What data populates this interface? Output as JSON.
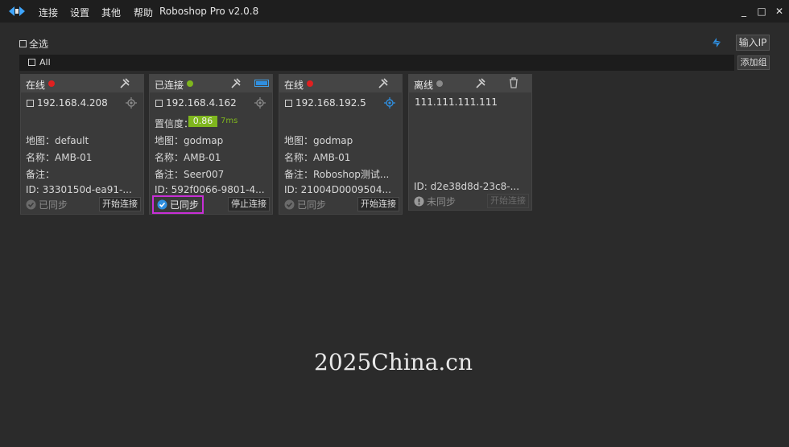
{
  "window": {
    "title": "Roboshop Pro v2.0.8",
    "menu": [
      "连接",
      "设置",
      "其他",
      "帮助"
    ],
    "controls": {
      "minimize": "_",
      "maximize": "□",
      "close": "✕"
    }
  },
  "toolbar": {
    "select_all": "全选",
    "input_ip": "输入IP",
    "add_group": "添加组"
  },
  "group": {
    "name": "All"
  },
  "robots": [
    {
      "status": "在线",
      "status_color": "#e02020",
      "ip": "192.168.4.208",
      "map": "地图：default",
      "name": "名称：AMB-01",
      "note": "备注：",
      "id": "ID: 3330150d-ea91-...",
      "sync": "已同步",
      "action": "开始连接"
    },
    {
      "status": "已连接",
      "status_color": "#7fb61e",
      "ip": "192.168.4.162",
      "confidence_label": "置信度：",
      "confidence_value": "0.86",
      "latency": "7ms",
      "map": "地图：godmap",
      "name": "名称：AMB-01",
      "note": "备注：Seer007",
      "id": "ID: 592f0066-9801-4...",
      "sync": "已同步",
      "action": "停止连接"
    },
    {
      "status": "在线",
      "status_color": "#e02020",
      "ip": "192.168.192.5",
      "map": "地图：godmap",
      "name": "名称：AMB-01",
      "note": "备注：Roboshop测试...",
      "id": "ID: 21004D0009504...",
      "sync": "已同步",
      "action": "开始连接"
    },
    {
      "status": "离线",
      "status_color": "#8a8a8a",
      "ip": "111.111.111.111",
      "id": "ID: d2e38d8d-23c8-...",
      "sync": "未同步",
      "action": "开始连接"
    }
  ],
  "watermark": "2025China.cn",
  "icons": {
    "logo": "roboshop-logo-icon",
    "refresh": "refresh-icon",
    "tool": "wrench-hammer-icon",
    "battery": "battery-icon",
    "trash": "trash-icon",
    "target": "crosshair-icon",
    "sync_ok": "check-circle-icon",
    "sync_warn": "exclamation-circle-icon"
  },
  "colors": {
    "accent_blue": "#2f8fe0",
    "highlight": "#c82fd6",
    "confidence_green": "#7fb61e"
  }
}
